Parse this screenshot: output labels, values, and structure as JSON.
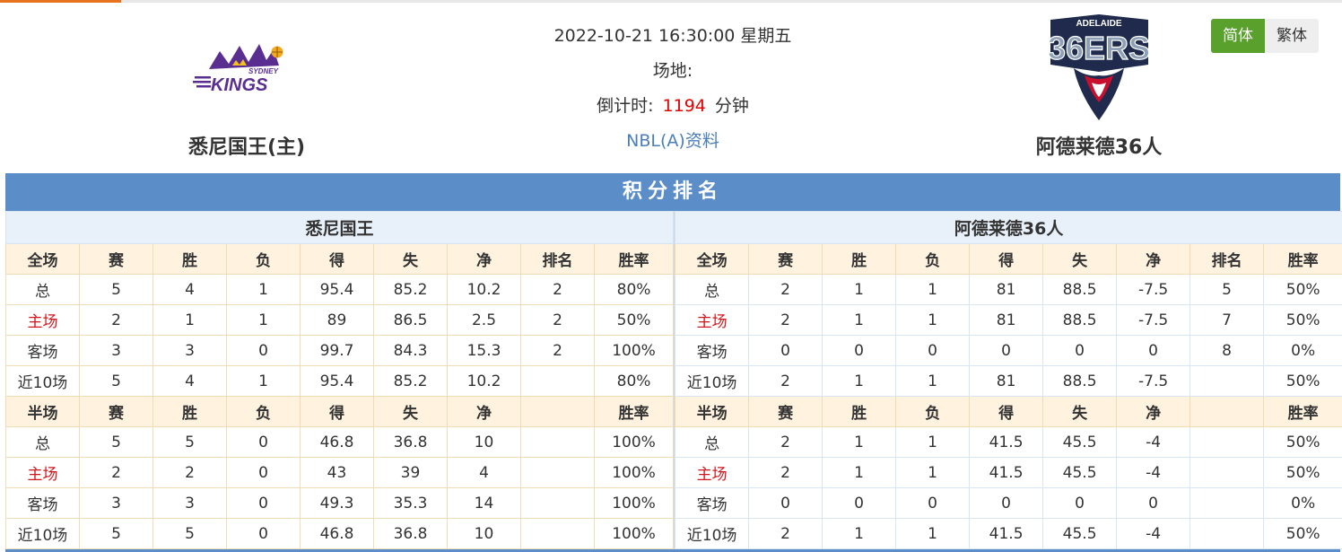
{
  "match": {
    "datetime": "2022-10-21 16:30:00 星期五",
    "venue_label": "场地:",
    "countdown_label": "倒计时:",
    "countdown_value": "1194",
    "countdown_unit": "分钟",
    "league_link": "NBL(A)资料"
  },
  "home_team": {
    "name": "悉尼国王(主)",
    "logo_text_top": "SYDNEY",
    "logo_text_main": "KINGS"
  },
  "away_team": {
    "name": "阿德莱德36人",
    "logo_text_top": "ADELAIDE",
    "logo_text_main": "36ERS"
  },
  "lang": {
    "simplified": "简体",
    "traditional": "繁体"
  },
  "colors": {
    "accent": "#5aa02c",
    "banner": "#5b8ec9",
    "home_red": "#d0161b",
    "countdown_red": "#e60000",
    "link": "#4a7fb8"
  },
  "standings": {
    "title": "积分排名",
    "full_headers": [
      "全场",
      "赛",
      "胜",
      "负",
      "得",
      "失",
      "净",
      "排名",
      "胜率"
    ],
    "half_headers": [
      "半场",
      "赛",
      "胜",
      "负",
      "得",
      "失",
      "净",
      "",
      "胜率"
    ],
    "left": {
      "team": "悉尼国王",
      "full": [
        [
          "总",
          "5",
          "4",
          "1",
          "95.4",
          "85.2",
          "10.2",
          "2",
          "80%"
        ],
        [
          "主场",
          "2",
          "1",
          "1",
          "89",
          "86.5",
          "2.5",
          "2",
          "50%"
        ],
        [
          "客场",
          "3",
          "3",
          "0",
          "99.7",
          "84.3",
          "15.3",
          "2",
          "100%"
        ],
        [
          "近10场",
          "5",
          "4",
          "1",
          "95.4",
          "85.2",
          "10.2",
          "",
          "80%"
        ]
      ],
      "half": [
        [
          "总",
          "5",
          "5",
          "0",
          "46.8",
          "36.8",
          "10",
          "",
          "100%"
        ],
        [
          "主场",
          "2",
          "2",
          "0",
          "43",
          "39",
          "4",
          "",
          "100%"
        ],
        [
          "客场",
          "3",
          "3",
          "0",
          "49.3",
          "35.3",
          "14",
          "",
          "100%"
        ],
        [
          "近10场",
          "5",
          "5",
          "0",
          "46.8",
          "36.8",
          "10",
          "",
          "100%"
        ]
      ]
    },
    "right": {
      "team": "阿德莱德36人",
      "full": [
        [
          "总",
          "2",
          "1",
          "1",
          "81",
          "88.5",
          "-7.5",
          "5",
          "50%"
        ],
        [
          "主场",
          "2",
          "1",
          "1",
          "81",
          "88.5",
          "-7.5",
          "7",
          "50%"
        ],
        [
          "客场",
          "0",
          "0",
          "0",
          "0",
          "0",
          "0",
          "8",
          "0%"
        ],
        [
          "近10场",
          "2",
          "1",
          "1",
          "81",
          "88.5",
          "-7.5",
          "",
          "50%"
        ]
      ],
      "half": [
        [
          "总",
          "2",
          "1",
          "1",
          "41.5",
          "45.5",
          "-4",
          "",
          "50%"
        ],
        [
          "主场",
          "2",
          "1",
          "1",
          "41.5",
          "45.5",
          "-4",
          "",
          "50%"
        ],
        [
          "客场",
          "0",
          "0",
          "0",
          "0",
          "0",
          "0",
          "",
          "0%"
        ],
        [
          "近10场",
          "2",
          "1",
          "1",
          "41.5",
          "45.5",
          "-4",
          "",
          "50%"
        ]
      ]
    }
  }
}
